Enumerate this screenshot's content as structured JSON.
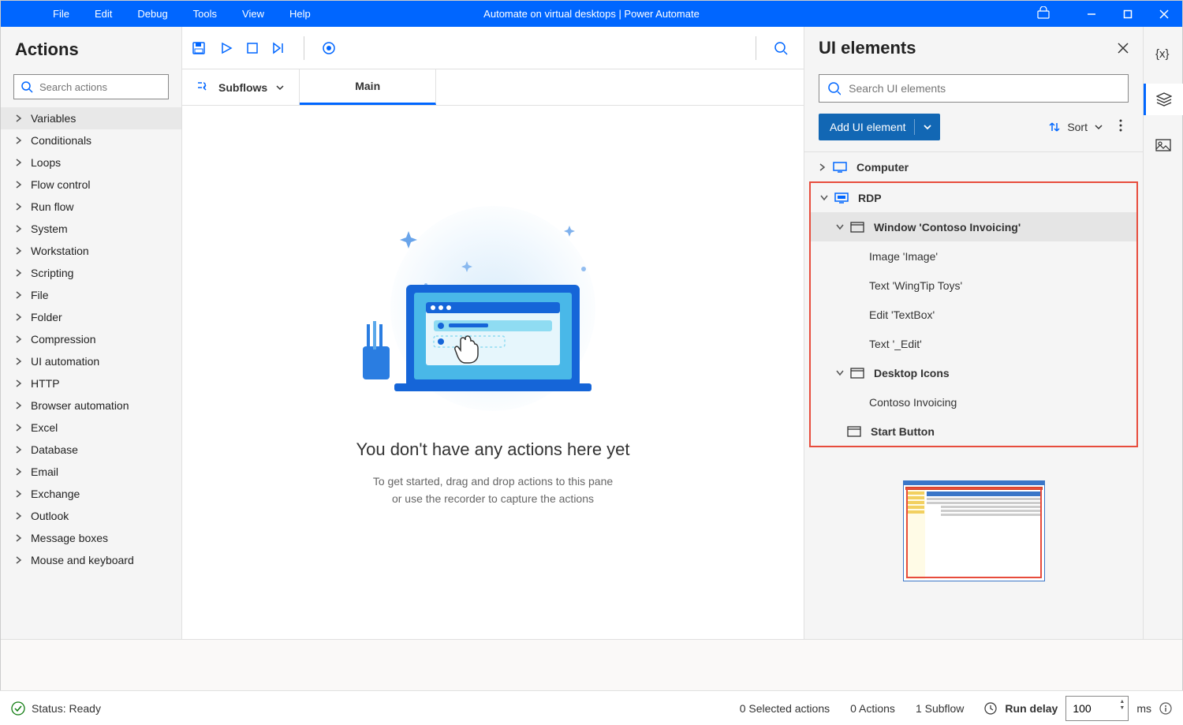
{
  "titlebar": {
    "menu": [
      "File",
      "Edit",
      "Debug",
      "Tools",
      "View",
      "Help"
    ],
    "title": "Automate on virtual desktops | Power Automate"
  },
  "actions_panel": {
    "title": "Actions",
    "search_placeholder": "Search actions",
    "items": [
      "Variables",
      "Conditionals",
      "Loops",
      "Flow control",
      "Run flow",
      "System",
      "Workstation",
      "Scripting",
      "File",
      "Folder",
      "Compression",
      "UI automation",
      "HTTP",
      "Browser automation",
      "Excel",
      "Database",
      "Email",
      "Exchange",
      "Outlook",
      "Message boxes",
      "Mouse and keyboard"
    ]
  },
  "workspace": {
    "subflows_label": "Subflows",
    "tab_main": "Main",
    "empty_title": "You don't have any actions here yet",
    "empty_sub": "To get started, drag and drop actions to this pane\nor use the recorder to capture the actions"
  },
  "ui_panel": {
    "title": "UI elements",
    "search_placeholder": "Search UI elements",
    "add_button": "Add UI element",
    "sort_label": "Sort",
    "tree": {
      "computer": "Computer",
      "rdp": "RDP",
      "window_contoso": "Window 'Contoso Invoicing'",
      "image_image": "Image 'Image'",
      "text_wingtip": "Text 'WingTip Toys'",
      "edit_textbox": "Edit 'TextBox'",
      "text_edit": "Text '_Edit'",
      "desktop_icons": "Desktop Icons",
      "contoso_invoicing": "Contoso Invoicing",
      "start_button": "Start Button"
    }
  },
  "statusbar": {
    "ready": "Status: Ready",
    "selected_actions": "0 Selected actions",
    "actions_count": "0 Actions",
    "subflows_count": "1 Subflow",
    "run_delay_label": "Run delay",
    "delay_value": "100",
    "ms": "ms"
  }
}
